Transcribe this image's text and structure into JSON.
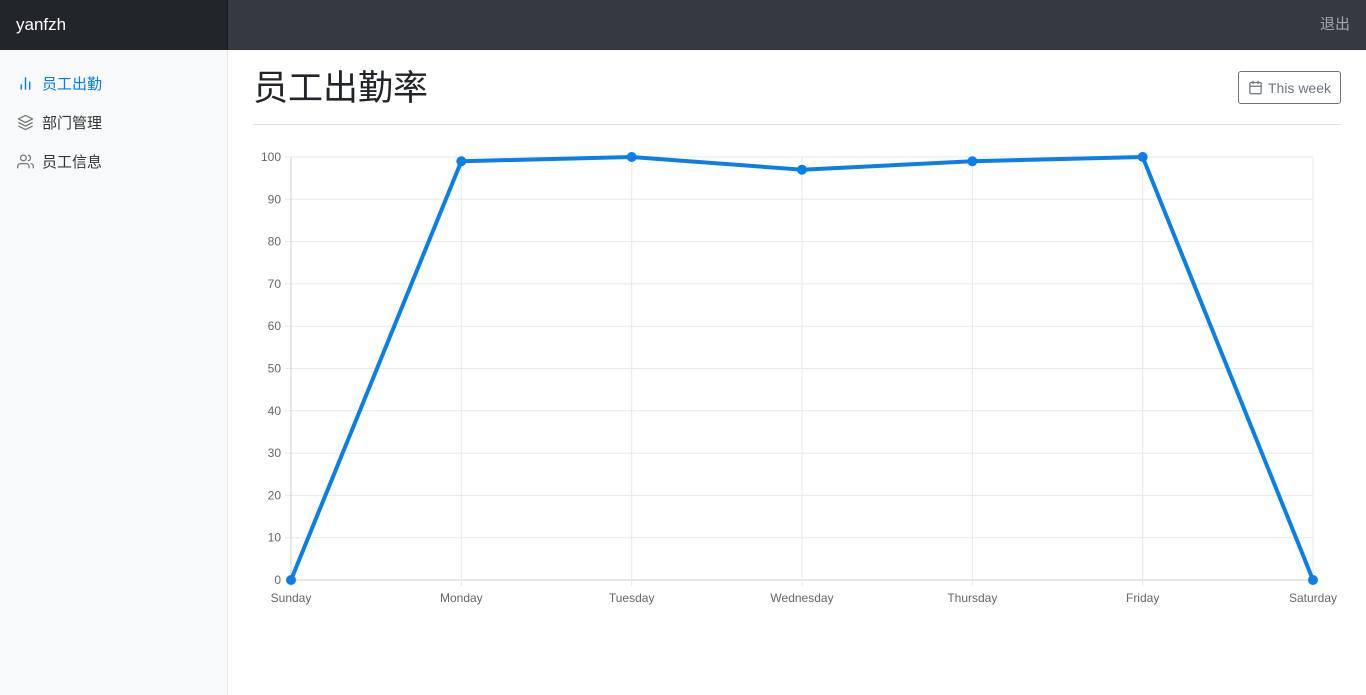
{
  "topbar": {
    "brand": "yanfzh",
    "signout": "退出"
  },
  "sidebar": {
    "items": [
      {
        "label": "员工出勤",
        "icon": "bar-chart-icon",
        "active": true
      },
      {
        "label": "部门管理",
        "icon": "layers-icon",
        "active": false
      },
      {
        "label": "员工信息",
        "icon": "users-icon",
        "active": false
      }
    ]
  },
  "main": {
    "title": "员工出勤率",
    "range_button": "This week"
  },
  "colors": {
    "accent": "#007bff",
    "line": "#0c7ee8",
    "topbar": "#343a40"
  },
  "chart_data": {
    "type": "line",
    "categories": [
      "Sunday",
      "Monday",
      "Tuesday",
      "Wednesday",
      "Thursday",
      "Friday",
      "Saturday"
    ],
    "series": [
      {
        "values": [
          0,
          99,
          100,
          97,
          99,
          100,
          0
        ]
      }
    ],
    "yticks": [
      "0",
      "10",
      "20",
      "30",
      "40",
      "50",
      "60",
      "70",
      "80",
      "90",
      "100"
    ],
    "ylim": [
      0,
      100
    ],
    "grid": true,
    "legend": "none"
  }
}
